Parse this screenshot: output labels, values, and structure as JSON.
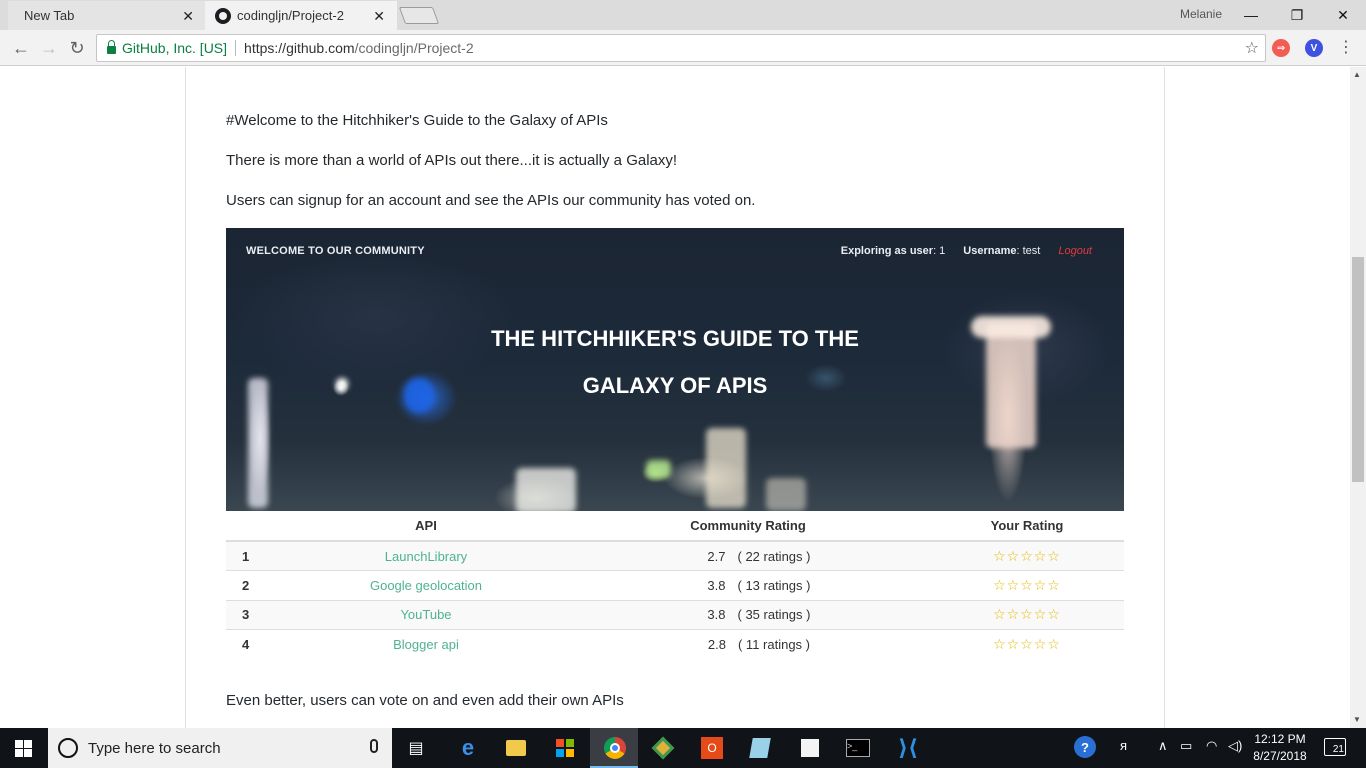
{
  "browser": {
    "tabs": [
      {
        "title": "New Tab",
        "active": false
      },
      {
        "title": "codingljn/Project-2",
        "active": true
      }
    ],
    "profile_name": "Melanie",
    "address": {
      "security_label": "GitHub, Inc. [US]",
      "url_host": "https://github.com",
      "url_path": "/codingljn/Project-2"
    },
    "icons": {
      "back": "arrow-left-icon",
      "forward": "arrow-right-icon",
      "reload": "reload-icon",
      "bookmark": "star-icon",
      "menu": "more-vert-icon"
    }
  },
  "readme": {
    "heading_line": "#Welcome to the Hitchhiker's Guide to the Galaxy of APIs",
    "intro_line": "There is more than a world of APIs out there...it is actually a Galaxy!",
    "signup_line": "Users can signup for an account and see the APIs our community has voted on.",
    "vote_line": "Even better, users can vote on and even add their own APIs"
  },
  "banner": {
    "nav_title": "WELCOME TO OUR COMMUNITY",
    "exploring_label": "Exploring as user",
    "exploring_value": ": 1",
    "username_label": "Username",
    "username_value": ": test",
    "logout_label": "Logout",
    "title_line1": "THE HITCHHIKER'S GUIDE TO THE",
    "title_line2": "GALAXY OF APIS"
  },
  "api_table": {
    "headers": [
      "API",
      "Community Rating",
      "Your Rating"
    ],
    "rows": [
      {
        "rank": "1",
        "api": "LaunchLibrary",
        "rating": "2.7",
        "count": "( 22 ratings )",
        "stars": "☆☆☆☆☆"
      },
      {
        "rank": "2",
        "api": "Google geolocation",
        "rating": "3.8",
        "count": "( 13 ratings )",
        "stars": "☆☆☆☆☆"
      },
      {
        "rank": "3",
        "api": "YouTube",
        "rating": "3.8",
        "count": "( 35 ratings )",
        "stars": "☆☆☆☆☆"
      },
      {
        "rank": "4",
        "api": "Blogger api",
        "rating": "2.8",
        "count": "( 11 ratings )",
        "stars": "☆☆☆☆☆"
      }
    ]
  },
  "taskbar": {
    "search_placeholder": "Type here to search",
    "time": "12:12 PM",
    "date": "8/27/2018",
    "notification_count": "21"
  },
  "colors": {
    "link_green": "#4fb38e",
    "logout_red": "#e03a3a",
    "star_gold": "#e6b800",
    "secure_green": "#0b8043"
  }
}
